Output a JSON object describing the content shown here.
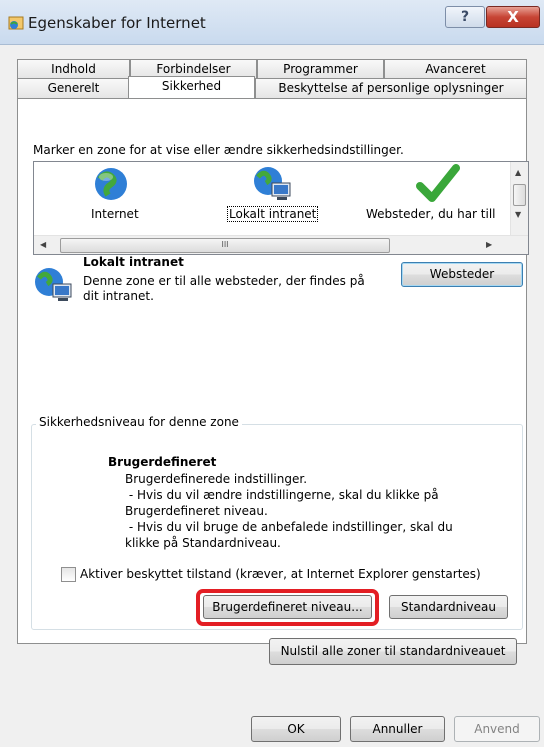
{
  "window": {
    "title": "Egenskaber for Internet",
    "help_label": "?",
    "close_label": "X"
  },
  "tabs_row1": [
    "Indhold",
    "Forbindelser",
    "Programmer",
    "Avanceret"
  ],
  "tabs_row2": [
    "Generelt",
    "Sikkerhed",
    "Beskyttelse af personlige oplysninger"
  ],
  "active_tab": "Sikkerhed",
  "zones": {
    "instruction": "Marker en zone for at vise eller ændre sikkerhedsindstillinger.",
    "items": [
      "Internet",
      "Lokalt intranet",
      "Websteder, du har till"
    ],
    "selected": "Lokalt intranet",
    "scroll_thumb": "III"
  },
  "selected_zone": {
    "title": "Lokalt intranet",
    "description": "Denne zone er til alle websteder, der findes på dit intranet.",
    "sites_button": "Websteder"
  },
  "security_level": {
    "group_label": "Sikkerhedsniveau for denne zone",
    "title": "Brugerdefineret",
    "lines": [
      "Brugerdefinerede indstillinger.",
      " - Hvis du vil ændre indstillingerne, skal du klikke på",
      "Brugerdefineret niveau.",
      " - Hvis du vil bruge de anbefalede indstillinger, skal du",
      "klikke på Standardniveau."
    ],
    "protected_mode_label": "Aktiver beskyttet tilstand (kræver, at Internet Explorer genstartes)",
    "protected_mode_checked": false,
    "custom_level_button": "Brugerdefineret niveau...",
    "default_level_button": "Standardniveau",
    "highlight_color": "#e31e24"
  },
  "reset_all_button": "Nulstil alle zoner til standardniveauet",
  "footer": {
    "ok": "OK",
    "cancel": "Annuller",
    "apply": "Anvend"
  }
}
